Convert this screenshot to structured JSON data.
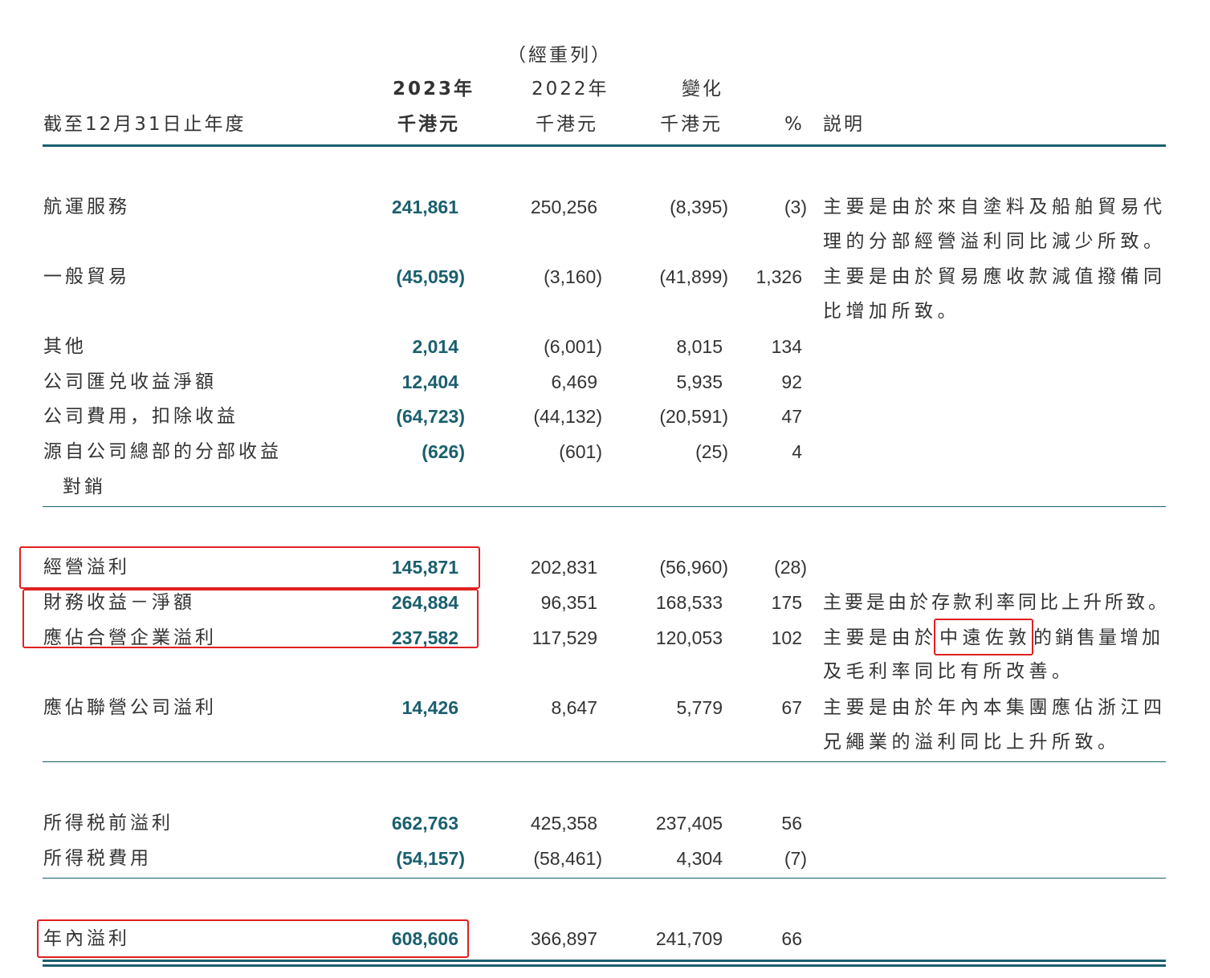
{
  "header": {
    "restated": "（經重列）",
    "year_current": "2023年",
    "year_prior": "2022年",
    "change": "變化",
    "period_label": "截至12月31日止年度",
    "unit_current": "千港元",
    "unit_prior": "千港元",
    "unit_change": "千港元",
    "percent": "%",
    "explanation": "説明"
  },
  "rows": [
    {
      "label": "航運服務",
      "cur": "241,861",
      "prior": "250,256",
      "chg": "(8,395)",
      "pct": "(3)",
      "note": [
        "主要是由於來自塗料及船舶貿易代",
        "理的分部經營溢利同比減少所致。"
      ]
    },
    {
      "label": "一般貿易",
      "cur": "(45,059)",
      "prior": "(3,160)",
      "chg": "(41,899)",
      "pct": "1,326",
      "note": [
        "主要是由於貿易應收款減值撥備同",
        "比增加所致。"
      ]
    },
    {
      "label": "其他",
      "cur": "2,014",
      "prior": "(6,001)",
      "chg": "8,015",
      "pct": "134"
    },
    {
      "label": "公司匯兑收益淨額",
      "cur": "12,404",
      "prior": "6,469",
      "chg": "5,935",
      "pct": "92"
    },
    {
      "label": "公司費用，扣除收益",
      "cur": "(64,723)",
      "prior": "(44,132)",
      "chg": "(20,591)",
      "pct": "47"
    },
    {
      "label": "源自公司總部的分部收益",
      "label2": "對銷",
      "cur": "(626)",
      "prior": "(601)",
      "chg": "(25)",
      "pct": "4"
    },
    {
      "label": "經營溢利",
      "cur": "145,871",
      "prior": "202,831",
      "chg": "(56,960)",
      "pct": "(28)"
    },
    {
      "label": "財務收益－淨額",
      "cur": "264,884",
      "prior": "96,351",
      "chg": "168,533",
      "pct": "175",
      "note": [
        "主要是由於存款利率同比上升所致。"
      ]
    },
    {
      "label": "應佔合營企業溢利",
      "cur": "237,582",
      "prior": "117,529",
      "chg": "120,053",
      "pct": "102",
      "note_parts": [
        "主要是由於",
        "中遠佐敦",
        "的銷售量增加"
      ],
      "note2": "及毛利率同比有所改善。"
    },
    {
      "label": "應佔聯營公司溢利",
      "cur": "14,426",
      "prior": "8,647",
      "chg": "5,779",
      "pct": "67",
      "note": [
        "主要是由於年內本集團應佔浙江四",
        "兄繩業的溢利同比上升所致。"
      ]
    },
    {
      "label": "所得税前溢利",
      "cur": "662,763",
      "prior": "425,358",
      "chg": "237,405",
      "pct": "56"
    },
    {
      "label": "所得税費用",
      "cur": "(54,157)",
      "prior": "(58,461)",
      "chg": "4,304",
      "pct": "(7)"
    },
    {
      "label": "年內溢利",
      "cur": "608,606",
      "prior": "366,897",
      "chg": "241,709",
      "pct": "66"
    }
  ],
  "colors": {
    "accent": "#1a5f6e",
    "highlight": "#e02020",
    "text": "#333333"
  }
}
